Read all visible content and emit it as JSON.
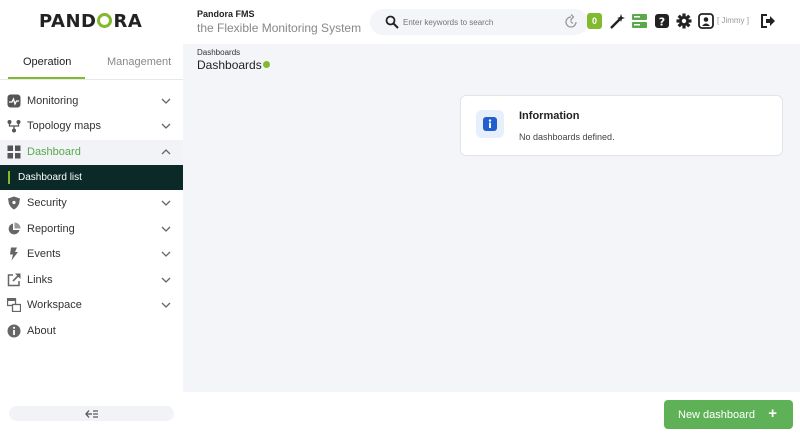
{
  "header": {
    "logo_text_a": "PAND",
    "logo_text_b": "RA",
    "app_title": "Pandora FMS",
    "app_subtitle": "the Flexible Monitoring System",
    "search_placeholder": "Enter keywords to search",
    "alert_count": "0",
    "user_label": "[ Jimmy ]"
  },
  "sidebar": {
    "tabs": [
      {
        "label": "Operation",
        "active": true
      },
      {
        "label": "Management",
        "active": false
      }
    ],
    "items": [
      {
        "label": "Monitoring",
        "icon": "monitoring-icon",
        "expanded": false
      },
      {
        "label": "Topology maps",
        "icon": "topology-icon",
        "expanded": false
      },
      {
        "label": "Dashboard",
        "icon": "dashboard-icon",
        "expanded": true
      },
      {
        "label": "Security",
        "icon": "shield-icon",
        "expanded": false
      },
      {
        "label": "Reporting",
        "icon": "pie-chart-icon",
        "expanded": false
      },
      {
        "label": "Events",
        "icon": "lightning-icon",
        "expanded": false
      },
      {
        "label": "Links",
        "icon": "external-link-icon",
        "expanded": false
      },
      {
        "label": "Workspace",
        "icon": "workspace-icon",
        "expanded": false
      },
      {
        "label": "About",
        "icon": "info-icon",
        "expanded": false
      }
    ],
    "sub_item": "Dashboard list"
  },
  "main": {
    "breadcrumb": "Dashboards",
    "title": "Dashboards",
    "info": {
      "title": "Information",
      "text": "No dashboards defined."
    }
  },
  "footer": {
    "new_button": "New dashboard",
    "new_button_symbol": "+"
  },
  "colors": {
    "accent": "#82b92e",
    "button": "#5fb157",
    "active_sub": "#0b2a27",
    "info_icon": "#1f5fce"
  }
}
